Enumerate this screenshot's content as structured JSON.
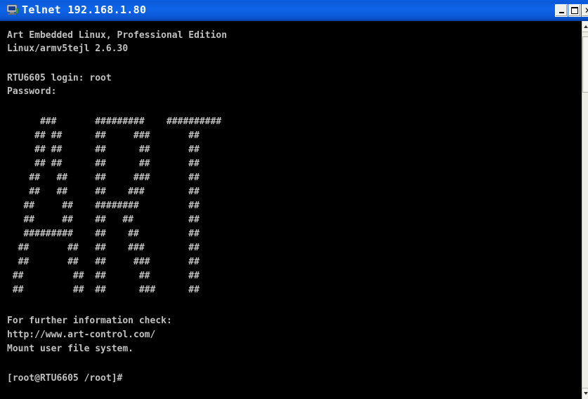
{
  "window": {
    "title": "Telnet 192.168.1.80",
    "icon": "telnet-terminal-icon",
    "controls": {
      "minimize": "minimize-icon",
      "maximize": "maximize-icon",
      "close": "close-icon"
    }
  },
  "colors": {
    "titlebar": "#0b59d8",
    "console_background": "#000000",
    "console_text": "#c0c0c0",
    "title_text": "#ffffff"
  },
  "console": {
    "lines": [
      "Art Embedded Linux, Professional Edition",
      "Linux/armv5tejl 2.6.30",
      "",
      "RTU6605 login: root",
      "Password:",
      "",
      "      ###       #########    ##########",
      "     ## ##      ##     ###       ##",
      "     ## ##      ##      ##       ##",
      "     ## ##      ##      ##       ##",
      "    ##   ##     ##     ###       ##",
      "    ##   ##     ##    ###        ##",
      "   ##     ##    ########         ##",
      "   ##     ##    ##   ##          ##",
      "   #########    ##    ##         ##",
      "  ##       ##   ##    ###        ##",
      "  ##       ##   ##     ###       ##",
      " ##         ##  ##      ##       ##",
      " ##         ##  ##      ###      ##",
      "",
      "For further information check:",
      "http://www.art-control.com/",
      "Mount user file system.",
      "",
      "[root@RTU6605 /root]#"
    ]
  }
}
